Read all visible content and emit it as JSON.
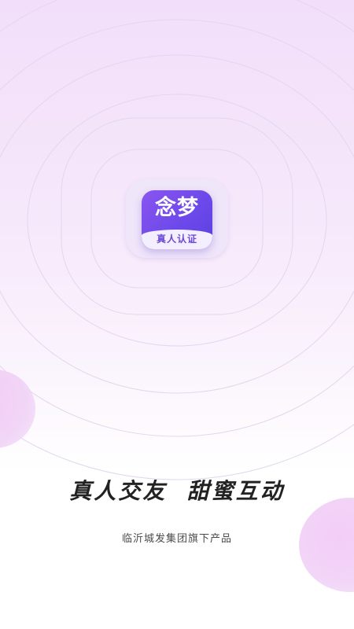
{
  "app": {
    "name": "念梦",
    "badge": "真人认证"
  },
  "splash": {
    "tagline_left": "真人交友",
    "tagline_right": "甜蜜互动",
    "footer": "临沂城发集团旗下产品"
  },
  "colors": {
    "accent_purple": "#6d49ea",
    "ring": "#e3d6ee",
    "blob_pink": "#f3c9f5",
    "text_dark": "#222222"
  },
  "icons": {
    "app_logo": "app-logo-icon"
  }
}
